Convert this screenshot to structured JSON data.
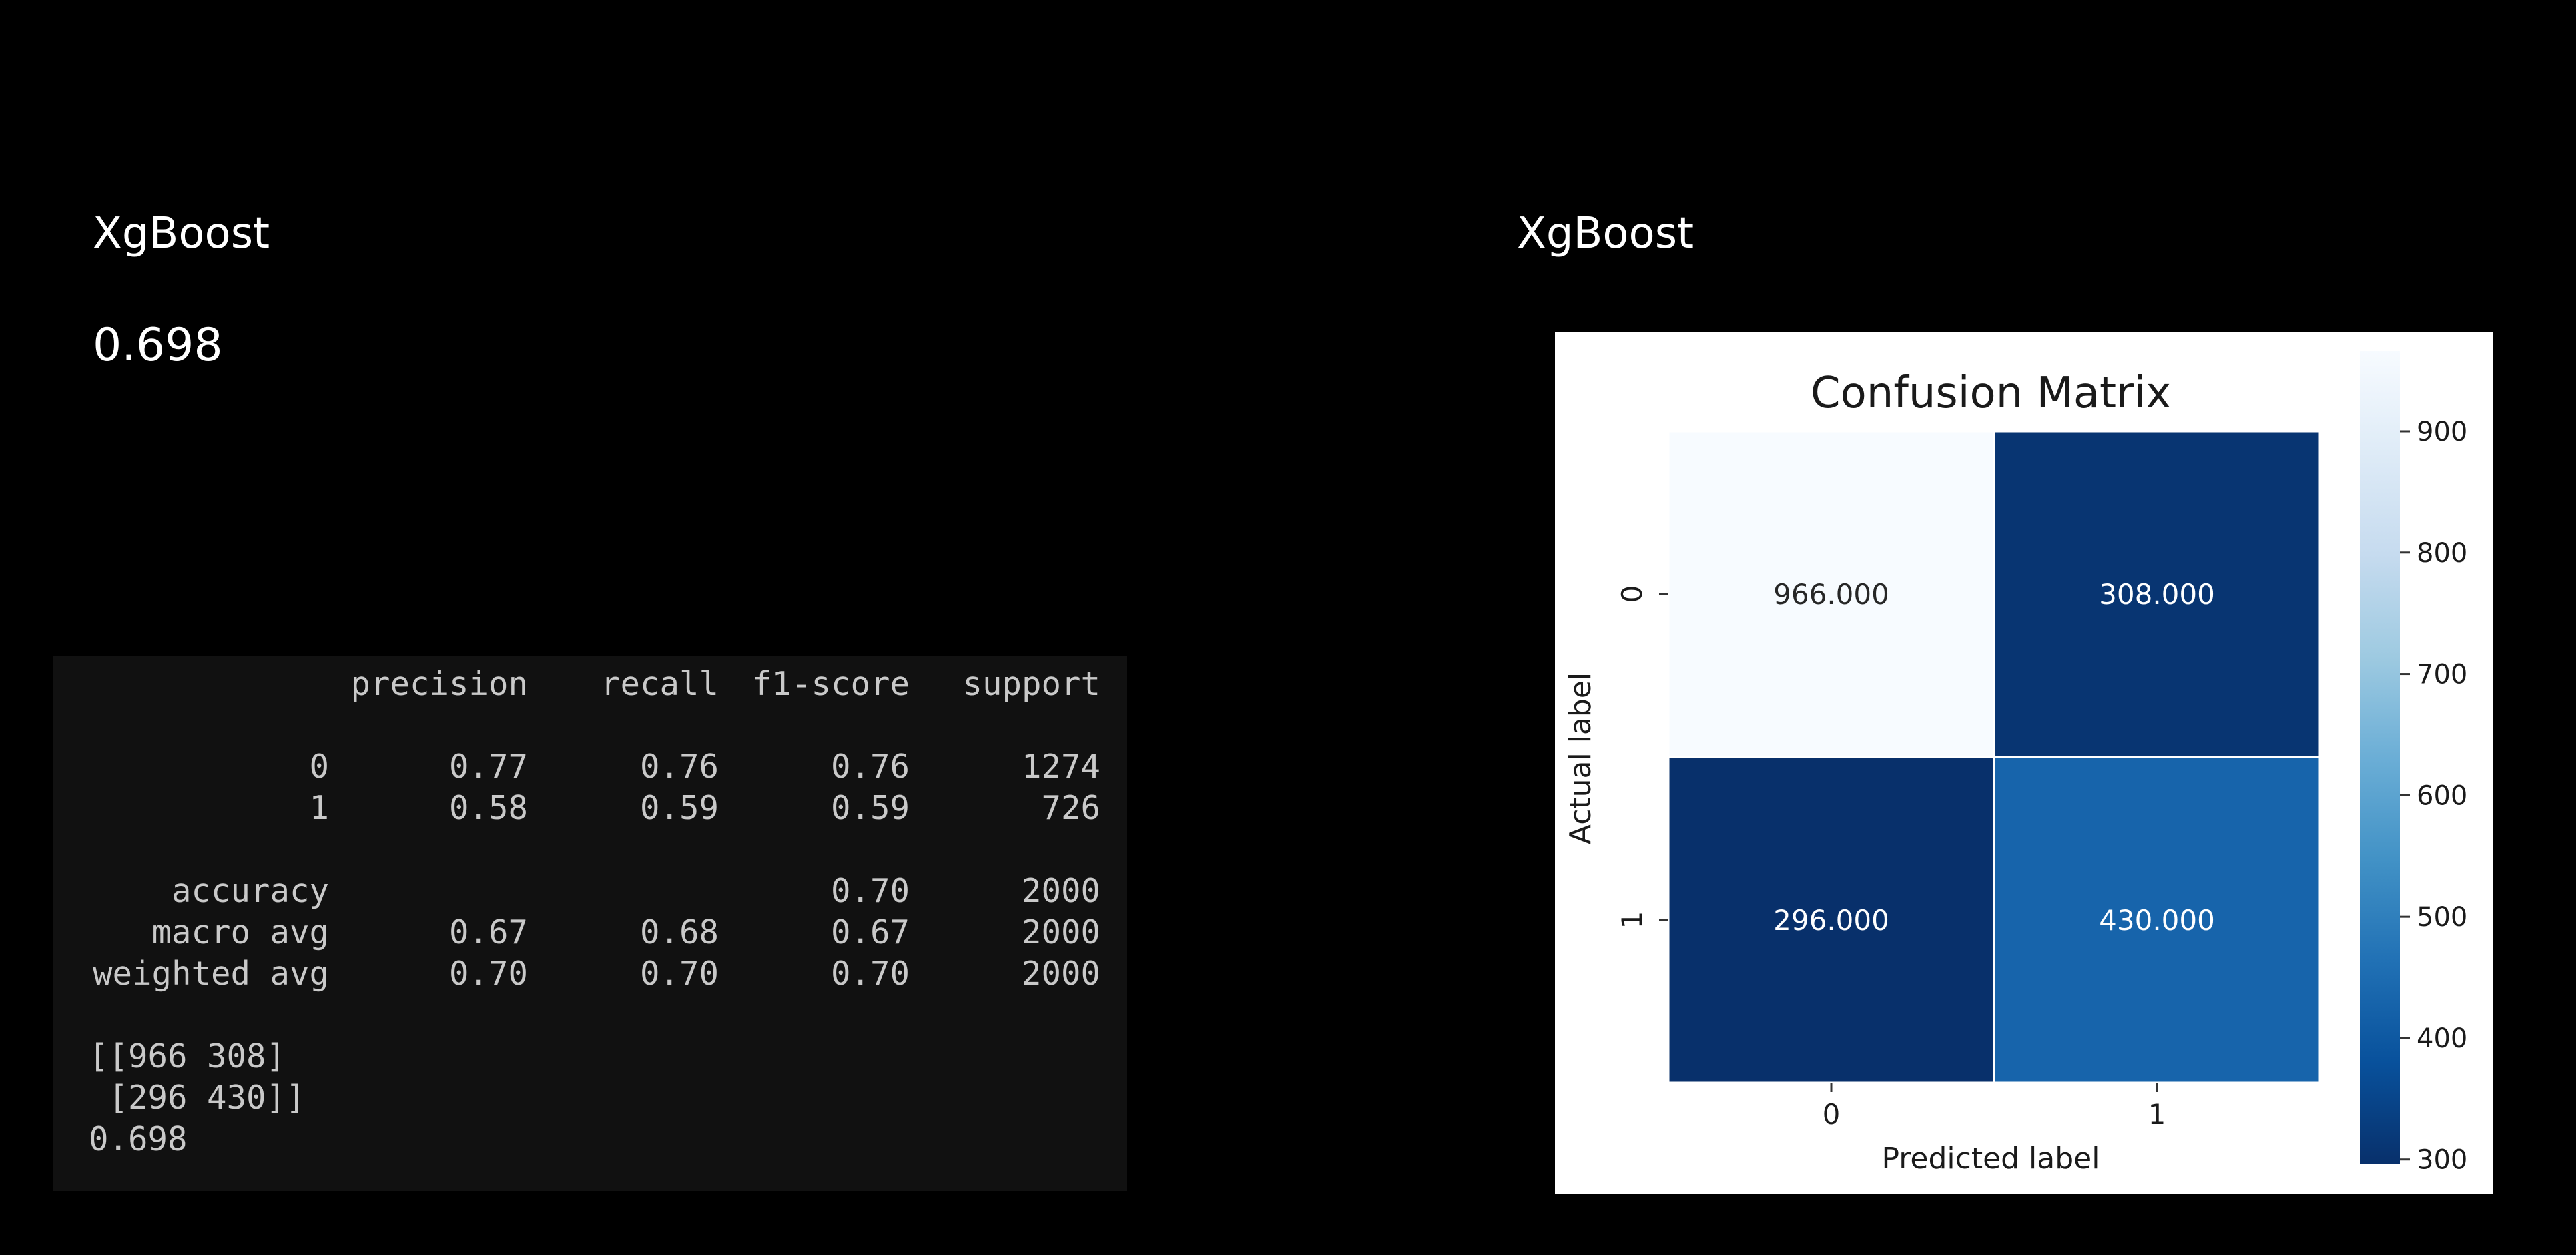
{
  "left_title": "XgBoost",
  "right_title": "XgBoost",
  "score": "0.698",
  "report": {
    "headers": [
      "precision",
      "recall",
      "f1-score",
      "support"
    ],
    "rows": [
      {
        "label": "0",
        "precision": "0.77",
        "recall": "0.76",
        "f1": "0.76",
        "support": "1274"
      },
      {
        "label": "1",
        "precision": "0.58",
        "recall": "0.59",
        "f1": "0.59",
        "support": "726"
      },
      {
        "label": "accuracy",
        "precision": "",
        "recall": "",
        "f1": "0.70",
        "support": "2000"
      },
      {
        "label": "macro avg",
        "precision": "0.67",
        "recall": "0.68",
        "f1": "0.67",
        "support": "2000"
      },
      {
        "label": "weighted avg",
        "precision": "0.70",
        "recall": "0.70",
        "f1": "0.70",
        "support": "2000"
      }
    ],
    "matrix_lines": [
      "[[966 308]",
      " [296 430]]"
    ],
    "score_line": "0.698"
  },
  "chart_data": {
    "type": "heatmap",
    "title": "Confusion Matrix",
    "xlabel": "Predicted label",
    "ylabel": "Actual label",
    "x_categories": [
      "0",
      "1"
    ],
    "y_categories": [
      "0",
      "1"
    ],
    "values": [
      [
        966,
        308
      ],
      [
        296,
        430
      ]
    ],
    "cell_labels": [
      [
        "966.000",
        "308.000"
      ],
      [
        "296.000",
        "430.000"
      ]
    ],
    "colorscale": "Blues",
    "colorbar_range": [
      296,
      966
    ],
    "colorbar_ticks": [
      900,
      800,
      700,
      600,
      500,
      400,
      300
    ],
    "colors": {
      "low": "#08306b",
      "high": "#f7fbff",
      "cell_border": "#ffffff"
    }
  }
}
